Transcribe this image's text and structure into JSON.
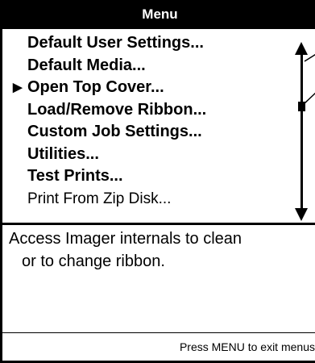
{
  "header": {
    "title": "Menu"
  },
  "menu": {
    "items": [
      {
        "label": "Default User Settings...",
        "selected": false,
        "style": "bold"
      },
      {
        "label": "Default Media...",
        "selected": false,
        "style": "bold"
      },
      {
        "label": "Open Top Cover...",
        "selected": true,
        "style": "bold"
      },
      {
        "label": "Load/Remove Ribbon...",
        "selected": false,
        "style": "bold"
      },
      {
        "label": "Custom Job Settings...",
        "selected": false,
        "style": "bold"
      },
      {
        "label": "Utilities...",
        "selected": false,
        "style": "bold"
      },
      {
        "label": "Test Prints...",
        "selected": false,
        "style": "bold"
      },
      {
        "label": "Print From Zip Disk...",
        "selected": false,
        "style": "normal"
      }
    ],
    "pointer_glyph": "▶"
  },
  "scrollbar": {
    "icons": [
      "up-arrow-icon",
      "down-arrow-icon"
    ]
  },
  "description": {
    "line1": "Access Imager internals to clean",
    "line2": "or to change ribbon."
  },
  "footer": {
    "hint": "Press MENU to exit menus"
  },
  "colors": {
    "background": "#ffffff",
    "foreground": "#000000"
  }
}
